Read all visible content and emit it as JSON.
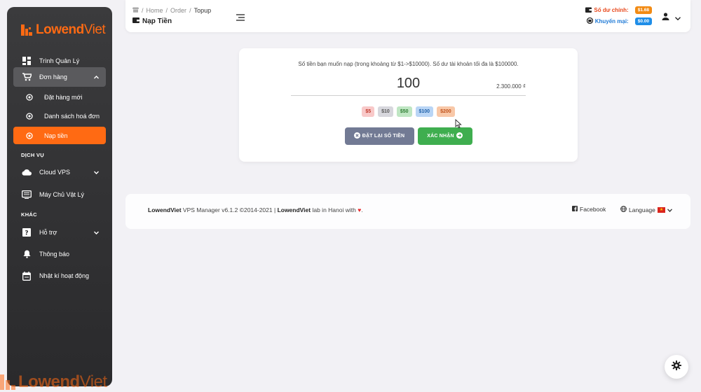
{
  "colors": {
    "accent": "#ff6a13",
    "sidebar_bg": "#2f2f31",
    "confirm": "#3fae4f",
    "reset": "#727a94",
    "balance_main": "#e8491d",
    "balance_promo": "#1f7ad6"
  },
  "logo": {
    "text_a": "Lowend",
    "text_b": "Viet"
  },
  "sidebar": {
    "items": [
      {
        "label": "Trình Quản Lý",
        "icon": "dashboard-icon"
      },
      {
        "label": "Đơn hàng",
        "icon": "cart-icon",
        "expanded": true
      },
      {
        "label": "Đặt hàng mới",
        "icon": "circle-dot-icon"
      },
      {
        "label": "Danh sách hoá đơn",
        "icon": "circle-dot-icon"
      },
      {
        "label": "Nạp tiền",
        "icon": "circle-dot-icon",
        "active": true
      },
      {
        "label": "Cloud VPS",
        "icon": "cloud-icon"
      },
      {
        "label": "Máy Chủ Vật Lý",
        "icon": "server-icon"
      },
      {
        "label": "Hỗ trợ",
        "icon": "help-icon"
      },
      {
        "label": "Thông báo",
        "icon": "bell-icon"
      },
      {
        "label": "Nhật kí hoạt động",
        "icon": "calendar-icon"
      }
    ],
    "sections": {
      "services": "DỊCH VỤ",
      "other": "KHÁC"
    }
  },
  "header": {
    "breadcrumb": [
      "Home",
      "Order",
      "Topup"
    ],
    "title": "Nạp Tiền",
    "balance_main_label": "Số dư chính:",
    "balance_main_value": "$1.68",
    "balance_promo_label": "Khuyến mại:",
    "balance_promo_value": "$0.00"
  },
  "topup": {
    "note": "Số tiền bạn muốn nạp (trong khoảng từ $1->$10000). Số dư tài khoản tối đa là $100000.",
    "amount": "100",
    "vnd": "2.300.000 ₫",
    "presets": [
      {
        "label": "$5",
        "bg": "#f8c9c9",
        "fg": "#c0392b"
      },
      {
        "label": "$10",
        "bg": "#d7d7dd",
        "fg": "#555"
      },
      {
        "label": "$50",
        "bg": "#bfe6c3",
        "fg": "#2e7d32"
      },
      {
        "label": "$100",
        "bg": "#b9d5f5",
        "fg": "#1d5fa8"
      },
      {
        "label": "$200",
        "bg": "#f8c8a8",
        "fg": "#c0501a"
      }
    ],
    "reset_label": "ĐẶT LẠI SỐ TIỀN",
    "confirm_label": "XÁC NHẬN"
  },
  "footer": {
    "brand": "LowendViet",
    "version_text": " VPS Manager v6.1.2 ©2014-2021 | ",
    "brand2": "LowendViet",
    "tail": " lab in Hanoi with ",
    "heart": "♥",
    "facebook": "Facebook",
    "language": "Language"
  }
}
